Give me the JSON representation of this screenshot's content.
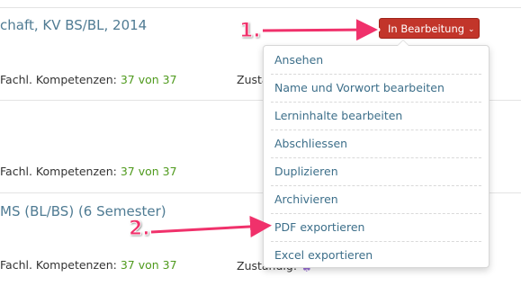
{
  "courses": [
    {
      "title": "chaft, KV BS/BL, 2014",
      "competencies_label": "Fachl. Kompetenzen:",
      "competencies_value": "37 von 37",
      "responsible_label": "Zustä"
    },
    {
      "title": "",
      "competencies_label": "Fachl. Kompetenzen:",
      "competencies_value": "37 von 37",
      "responsible_label": ""
    },
    {
      "title": "MS (BL/BS) (6 Semester)",
      "competencies_label": "Fachl. Kompetenzen:",
      "competencies_value": "37 von 37",
      "responsible_label": "Zuständig:"
    }
  ],
  "status_button": {
    "label": "In Bearbeitung",
    "chevron": "⌄",
    "color": "#c2352a"
  },
  "menu": {
    "items": [
      "Ansehen",
      "Name und Vorwort bearbeiten",
      "Lerninhalte bearbeiten",
      "Abschliessen",
      "Duplizieren",
      "Archivieren",
      "PDF exportieren",
      "Excel exportieren"
    ]
  },
  "annotations": {
    "step1": "1.",
    "step2": "2.",
    "color": "#f0316b"
  },
  "icons": {
    "responsible_icon": "user-group-icon"
  }
}
